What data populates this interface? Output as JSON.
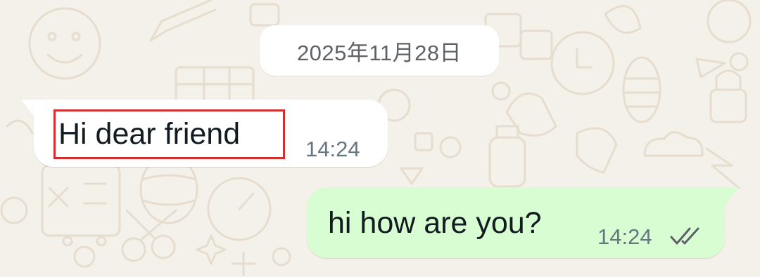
{
  "date_separator": "2025年11月28日",
  "messages": [
    {
      "direction": "incoming",
      "text": "Hi dear friend",
      "time": "14:24",
      "highlighted": true
    },
    {
      "direction": "outgoing",
      "text": "hi how are you?",
      "time": "14:24",
      "status_icon": "double-check-icon"
    }
  ],
  "colors": {
    "wallpaper": "#F4F0EA",
    "wallpaper_doodle": "#E6DDCF",
    "incoming_bubble": "#FFFFFF",
    "outgoing_bubble": "#D9FDD3",
    "text": "#111B21",
    "meta_text": "#667781",
    "highlight": "#D32F2F"
  }
}
